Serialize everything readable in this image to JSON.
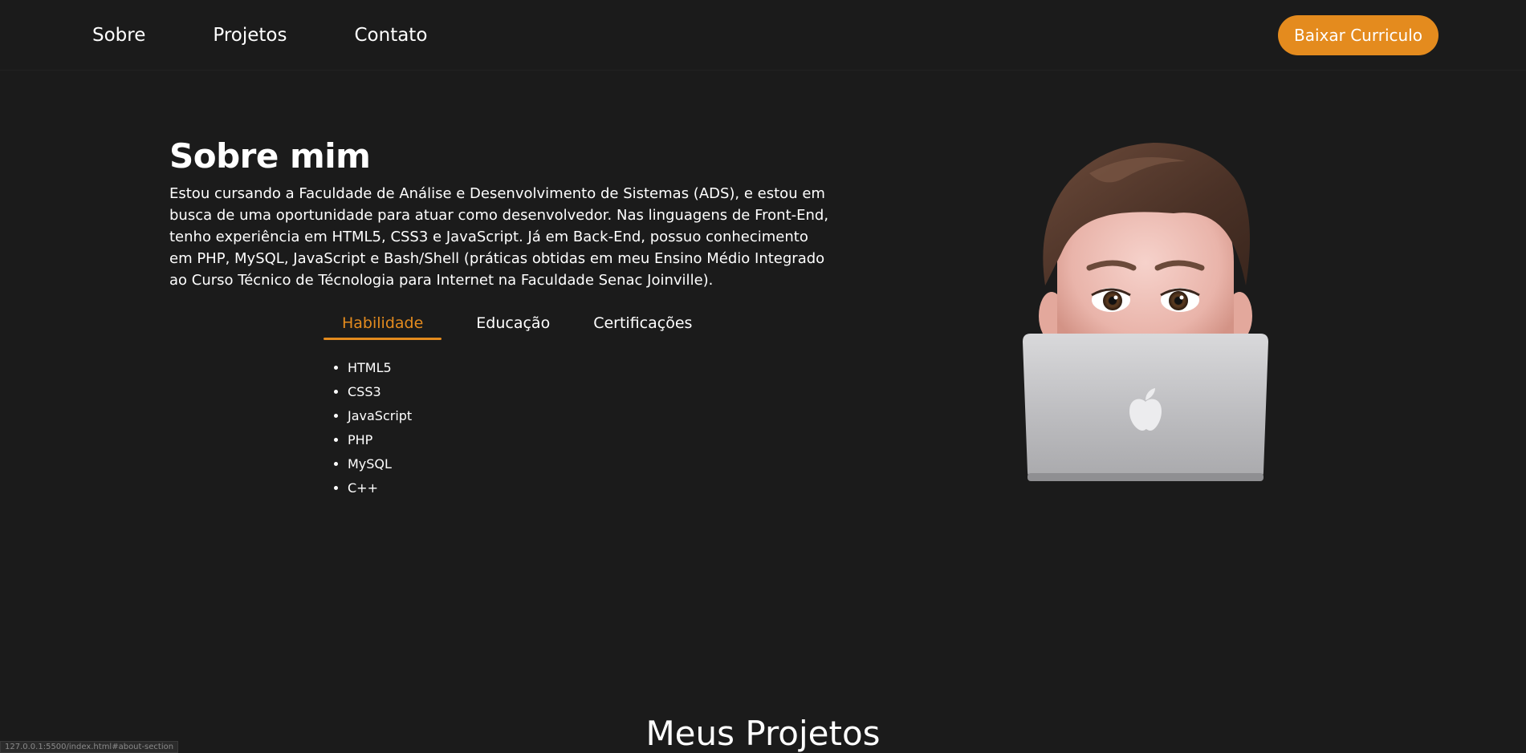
{
  "nav": {
    "links": [
      "Sobre",
      "Projetos",
      "Contato"
    ],
    "cv_button": "Baixar Curriculo"
  },
  "about": {
    "title": "Sobre mim",
    "text": "Estou cursando a Faculdade de Análise e Desenvolvimento de Sistemas (ADS), e estou em busca de uma oportunidade para atuar como desenvolvedor. Nas linguagens de Front-End, tenho experiência em HTML5, CSS3 e JavaScript. Já em Back-End, possuo conhecimento em PHP, MySQL, JavaScript e Bash/Shell (práticas obtidas em meu Ensino Médio Integrado ao Curso Técnico de Técnologia para Internet na Faculdade Senac Joinville).",
    "tabs": [
      "Habilidade",
      "Educação",
      "Certificações"
    ],
    "active_tab": "Habilidade",
    "skills": [
      "HTML5",
      "CSS3",
      "JavaScript",
      "PHP",
      "MySQL",
      "C++"
    ]
  },
  "projects": {
    "title": "Meus Projetos"
  },
  "status_bar": {
    "url": "127.0.0.1:5500/index.html#about-section"
  },
  "colors": {
    "background": "#1b1b1b",
    "accent": "#e48b1e",
    "text": "#ffffff"
  },
  "icons": {
    "avatar": "memoji-with-laptop-illustration",
    "laptop_logo": "apple-logo-icon"
  }
}
